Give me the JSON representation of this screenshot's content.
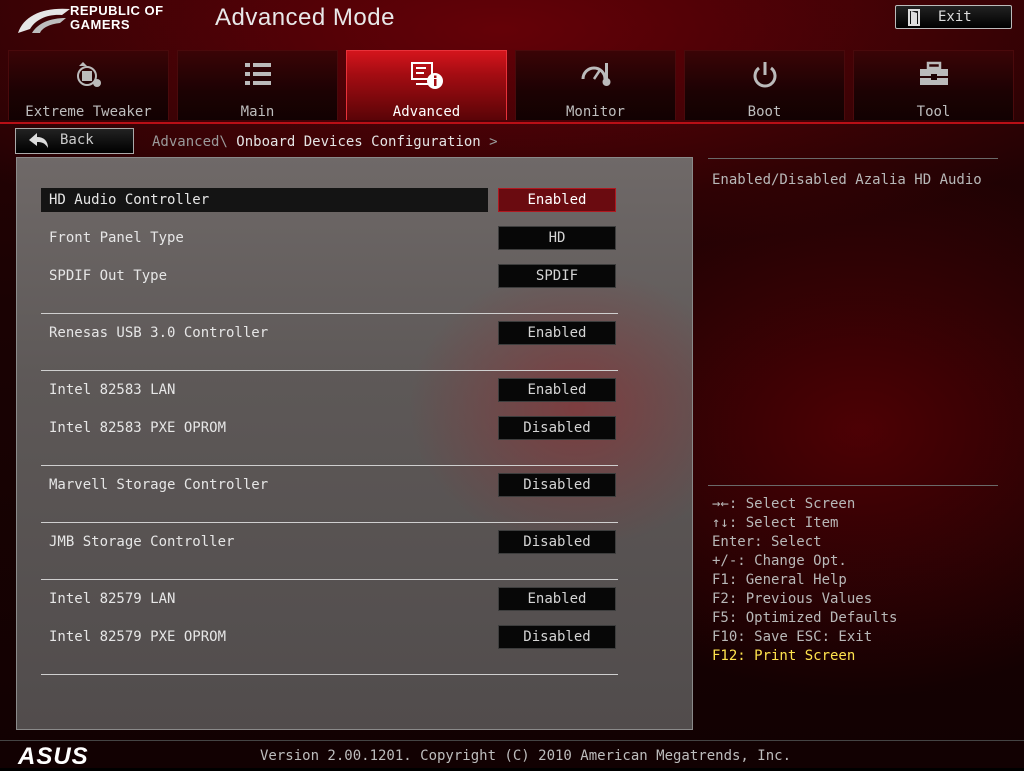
{
  "header": {
    "brand_line1": "REPUBLIC OF",
    "brand_line2": "GAMERS",
    "title": "Advanced Mode",
    "exit_label": "Exit"
  },
  "tabs": [
    {
      "label": "Extreme Tweaker",
      "icon": "tweaker-icon",
      "active": false
    },
    {
      "label": "Main",
      "icon": "list-icon",
      "active": false
    },
    {
      "label": "Advanced",
      "icon": "advanced-info-icon",
      "active": true
    },
    {
      "label": "Monitor",
      "icon": "monitor-gauge-icon",
      "active": false
    },
    {
      "label": "Boot",
      "icon": "power-icon",
      "active": false
    },
    {
      "label": "Tool",
      "icon": "toolbox-icon",
      "active": false
    }
  ],
  "nav": {
    "back_label": "Back",
    "breadcrumb_parent": "Advanced\\",
    "breadcrumb_current": "Onboard Devices Configuration",
    "breadcrumb_arrow": ">"
  },
  "settings": [
    {
      "label": "HD Audio Controller",
      "value": "Enabled",
      "selected": true
    },
    {
      "label": "Front Panel Type",
      "value": "HD",
      "selected": false
    },
    {
      "label": "SPDIF Out Type",
      "value": "SPDIF",
      "selected": false
    },
    {
      "label": "Renesas USB 3.0 Controller",
      "value": "Enabled",
      "selected": false
    },
    {
      "label": "Intel 82583 LAN",
      "value": "Enabled",
      "selected": false
    },
    {
      "label": "Intel 82583 PXE OPROM",
      "value": "Disabled",
      "selected": false
    },
    {
      "label": "Marvell Storage Controller",
      "value": "Disabled",
      "selected": false
    },
    {
      "label": "JMB Storage Controller",
      "value": "Disabled",
      "selected": false
    },
    {
      "label": "Intel 82579 LAN",
      "value": "Enabled",
      "selected": false
    },
    {
      "label": "Intel 82579 PXE OPROM",
      "value": "Disabled",
      "selected": false
    }
  ],
  "help": {
    "description": "Enabled/Disabled Azalia HD Audio"
  },
  "keys": [
    "→←: Select Screen",
    "↑↓: Select Item",
    "Enter: Select",
    "+/-: Change Opt.",
    "F1: General Help",
    "F2: Previous Values",
    "F5: Optimized Defaults",
    "F10: Save  ESC: Exit",
    "F12: Print Screen"
  ],
  "footer": {
    "brand": "ASUS",
    "version": "Version 2.00.1201. Copyright (C) 2010 American Megatrends, Inc."
  },
  "colors": {
    "accent_red": "#c4121a",
    "selected_value_bg": "#6a0b10",
    "hotkey_yellow": "#ffe34d"
  }
}
